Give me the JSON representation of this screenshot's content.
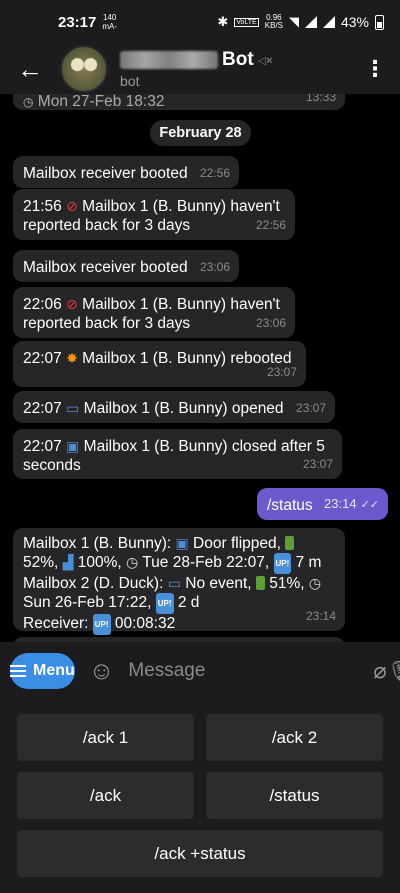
{
  "statusbar": {
    "time": "23:17",
    "net_top": "140",
    "net_bottom": "mA-",
    "volte": "VoLTE",
    "speed_top": "0.96",
    "speed_bottom": "KB/S",
    "battery": "43%"
  },
  "header": {
    "bot_name": "Bot",
    "subtitle": "bot"
  },
  "chat": {
    "top_partial": {
      "text": "Mon 27-Feb 18:32",
      "time": "13:33"
    },
    "date_separator": "February 28",
    "messages": [
      {
        "text": "Mailbox receiver booted",
        "time": "22:56"
      },
      {
        "text1": "21:56",
        "text2": "Mailbox 1 (B. Bunny) haven't",
        "text3": "reported back for 3 days",
        "time": "22:56"
      },
      {
        "text": "Mailbox receiver booted",
        "time": "23:06"
      },
      {
        "text1": "22:06",
        "text2": "Mailbox 1 (B. Bunny) haven't",
        "text3": "reported back for 3 days",
        "time": "23:06"
      },
      {
        "text1": "22:07",
        "text2": "Mailbox 1 (B. Bunny) rebooted",
        "time": "23:07"
      },
      {
        "text1": "22:07",
        "text2": "Mailbox 1 (B. Bunny) opened",
        "time": "23:07"
      },
      {
        "text1": "22:07",
        "text2": "Mailbox 1 (B. Bunny) closed after 5",
        "text3": "seconds",
        "time": "23:07"
      }
    ],
    "outgoing": {
      "text": "/status",
      "time": "23:14"
    },
    "status_reply": {
      "line1a": "Mailbox 1 (B. Bunny):",
      "line1b": "Door flipped,",
      "line2a": "52%,",
      "line2b": "100%,",
      "line2c": "Tue 28-Feb 22:07,",
      "line2d": "7 m",
      "line3a": "Mailbox 2 (D. Duck):",
      "line3b": "No event,",
      "line3c": "51%,",
      "line4a": "Sun 26-Feb 17:22,",
      "line4b": "2 d",
      "line5a": "Receiver:",
      "line5b": "00:08:32",
      "up_badge": "UP!",
      "time": "23:14"
    }
  },
  "input": {
    "menu_label": "Menu",
    "placeholder": "Message"
  },
  "keyboard": {
    "ack1": "/ack 1",
    "ack2": "/ack 2",
    "ack": "/ack",
    "status": "/status",
    "ack_status": "/ack +status"
  },
  "colors": {
    "accent": "#3a8ee6",
    "outgoing_bubble": "#6a5acd",
    "incoming_bubble": "#262628"
  }
}
